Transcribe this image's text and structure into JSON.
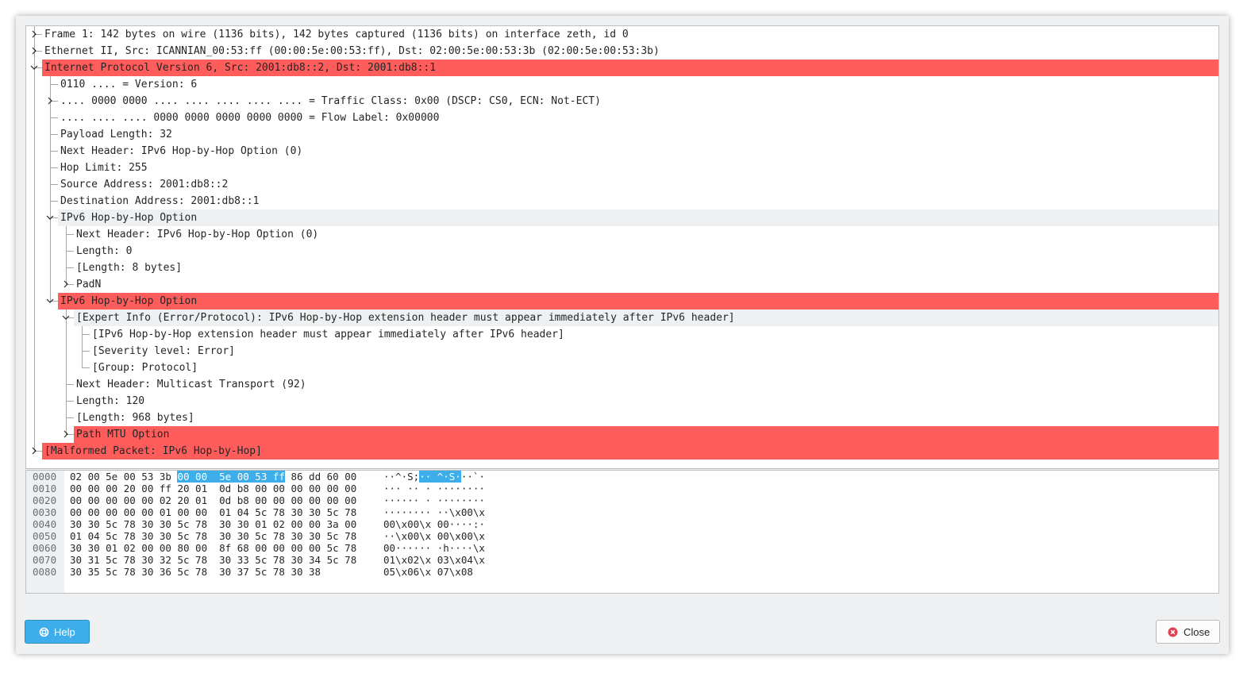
{
  "tree": {
    "rows": [
      {
        "text": "Frame 1: 142 bytes on wire (1136 bits), 142 bytes captured (1136 bits) on interface zeth, id 0",
        "level": 0,
        "arrow": "right",
        "state": "normal"
      },
      {
        "text": "Ethernet II, Src: ICANNIAN_00:53:ff (00:00:5e:00:53:ff), Dst: 02:00:5e:00:53:3b (02:00:5e:00:53:3b)",
        "level": 0,
        "arrow": "right",
        "state": "normal"
      },
      {
        "text": "Internet Protocol Version 6, Src: 2001:db8::2, Dst: 2001:db8::1",
        "level": 0,
        "arrow": "down",
        "state": "error"
      },
      {
        "text": "0110 .... = Version: 6",
        "level": 1,
        "arrow": "none",
        "state": "normal"
      },
      {
        "text": ".... 0000 0000 .... .... .... .... .... = Traffic Class: 0x00 (DSCP: CS0, ECN: Not-ECT)",
        "level": 1,
        "arrow": "right",
        "state": "normal"
      },
      {
        "text": ".... .... .... 0000 0000 0000 0000 0000 = Flow Label: 0x00000",
        "level": 1,
        "arrow": "none",
        "state": "normal"
      },
      {
        "text": "Payload Length: 32",
        "level": 1,
        "arrow": "none",
        "state": "normal"
      },
      {
        "text": "Next Header: IPv6 Hop-by-Hop Option (0)",
        "level": 1,
        "arrow": "none",
        "state": "normal"
      },
      {
        "text": "Hop Limit: 255",
        "level": 1,
        "arrow": "none",
        "state": "normal"
      },
      {
        "text": "Source Address: 2001:db8::2",
        "level": 1,
        "arrow": "none",
        "state": "normal"
      },
      {
        "text": "Destination Address: 2001:db8::1",
        "level": 1,
        "arrow": "none",
        "state": "normal"
      },
      {
        "text": "IPv6 Hop-by-Hop Option",
        "level": 1,
        "arrow": "down",
        "state": "selected"
      },
      {
        "text": "Next Header: IPv6 Hop-by-Hop Option (0)",
        "level": 2,
        "arrow": "none",
        "state": "normal"
      },
      {
        "text": "Length: 0",
        "level": 2,
        "arrow": "none",
        "state": "normal"
      },
      {
        "text": "[Length: 8 bytes]",
        "level": 2,
        "arrow": "none",
        "state": "normal"
      },
      {
        "text": "PadN",
        "level": 2,
        "arrow": "right",
        "state": "normal"
      },
      {
        "text": "IPv6 Hop-by-Hop Option",
        "level": 1,
        "arrow": "down",
        "state": "error"
      },
      {
        "text": "[Expert Info (Error/Protocol): IPv6 Hop-by-Hop extension header must appear immediately after IPv6 header]",
        "level": 2,
        "arrow": "down",
        "state": "selected"
      },
      {
        "text": "[IPv6 Hop-by-Hop extension header must appear immediately after IPv6 header]",
        "level": 3,
        "arrow": "none",
        "state": "normal"
      },
      {
        "text": "[Severity level: Error]",
        "level": 3,
        "arrow": "none",
        "state": "normal"
      },
      {
        "text": "[Group: Protocol]",
        "level": 3,
        "arrow": "none",
        "state": "normal"
      },
      {
        "text": "Next Header: Multicast Transport (92)",
        "level": 2,
        "arrow": "none",
        "state": "normal"
      },
      {
        "text": "Length: 120",
        "level": 2,
        "arrow": "none",
        "state": "normal"
      },
      {
        "text": "[Length: 968 bytes]",
        "level": 2,
        "arrow": "none",
        "state": "normal"
      },
      {
        "text": "Path MTU Option",
        "level": 2,
        "arrow": "right",
        "state": "error"
      },
      {
        "text": "[Malformed Packet: IPv6 Hop-by-Hop]",
        "level": 0,
        "arrow": "right",
        "state": "error"
      }
    ]
  },
  "hex": {
    "rows": [
      {
        "offset": "0000",
        "pre": "02 00 5e 00 53 3b ",
        "hl": "00 00  5e 00 53 ff",
        "post": " 86 dd 60 00",
        "apre": "··^·S;",
        "ahl": "·· ^·S·",
        "apost": "··`·"
      },
      {
        "offset": "0010",
        "pre": "00 00 00 20 00 ff 20 01  0d b8 00 00 00 00 00 00",
        "hl": "",
        "post": "",
        "apre": "··· ·· · ········",
        "ahl": "",
        "apost": ""
      },
      {
        "offset": "0020",
        "pre": "00 00 00 00 00 02 20 01  0d b8 00 00 00 00 00 00",
        "hl": "",
        "post": "",
        "apre": "······ · ········",
        "ahl": "",
        "apost": ""
      },
      {
        "offset": "0030",
        "pre": "00 00 00 00 00 01 00 00  01 04 5c 78 30 30 5c 78",
        "hl": "",
        "post": "",
        "apre": "········ ··\\x00\\x",
        "ahl": "",
        "apost": ""
      },
      {
        "offset": "0040",
        "pre": "30 30 5c 78 30 30 5c 78  30 30 01 02 00 00 3a 00",
        "hl": "",
        "post": "",
        "apre": "00\\x00\\x 00····:·",
        "ahl": "",
        "apost": ""
      },
      {
        "offset": "0050",
        "pre": "01 04 5c 78 30 30 5c 78  30 30 5c 78 30 30 5c 78",
        "hl": "",
        "post": "",
        "apre": "··\\x00\\x 00\\x00\\x",
        "ahl": "",
        "apost": ""
      },
      {
        "offset": "0060",
        "pre": "30 30 01 02 00 00 80 00  8f 68 00 00 00 00 5c 78",
        "hl": "",
        "post": "",
        "apre": "00······ ·h····\\x",
        "ahl": "",
        "apost": ""
      },
      {
        "offset": "0070",
        "pre": "30 31 5c 78 30 32 5c 78  30 33 5c 78 30 34 5c 78",
        "hl": "",
        "post": "",
        "apre": "01\\x02\\x 03\\x04\\x",
        "ahl": "",
        "apost": ""
      },
      {
        "offset": "0080",
        "pre": "30 35 5c 78 30 36 5c 78  30 37 5c 78 30 38",
        "hl": "",
        "post": "",
        "apre": "05\\x06\\x 07\\x08",
        "ahl": "",
        "apost": ""
      }
    ]
  },
  "buttons": {
    "help": {
      "label": "Help",
      "icon": "help-lifebuoy-icon"
    },
    "close": {
      "label": "Close",
      "icon": "close-circle-icon"
    }
  },
  "colors": {
    "error_row": "#ff5c5c",
    "selected_row": "#eff0f1",
    "hex_highlight": "#3daee9",
    "help_button": "#3daee9",
    "close_icon": "#da4453"
  }
}
